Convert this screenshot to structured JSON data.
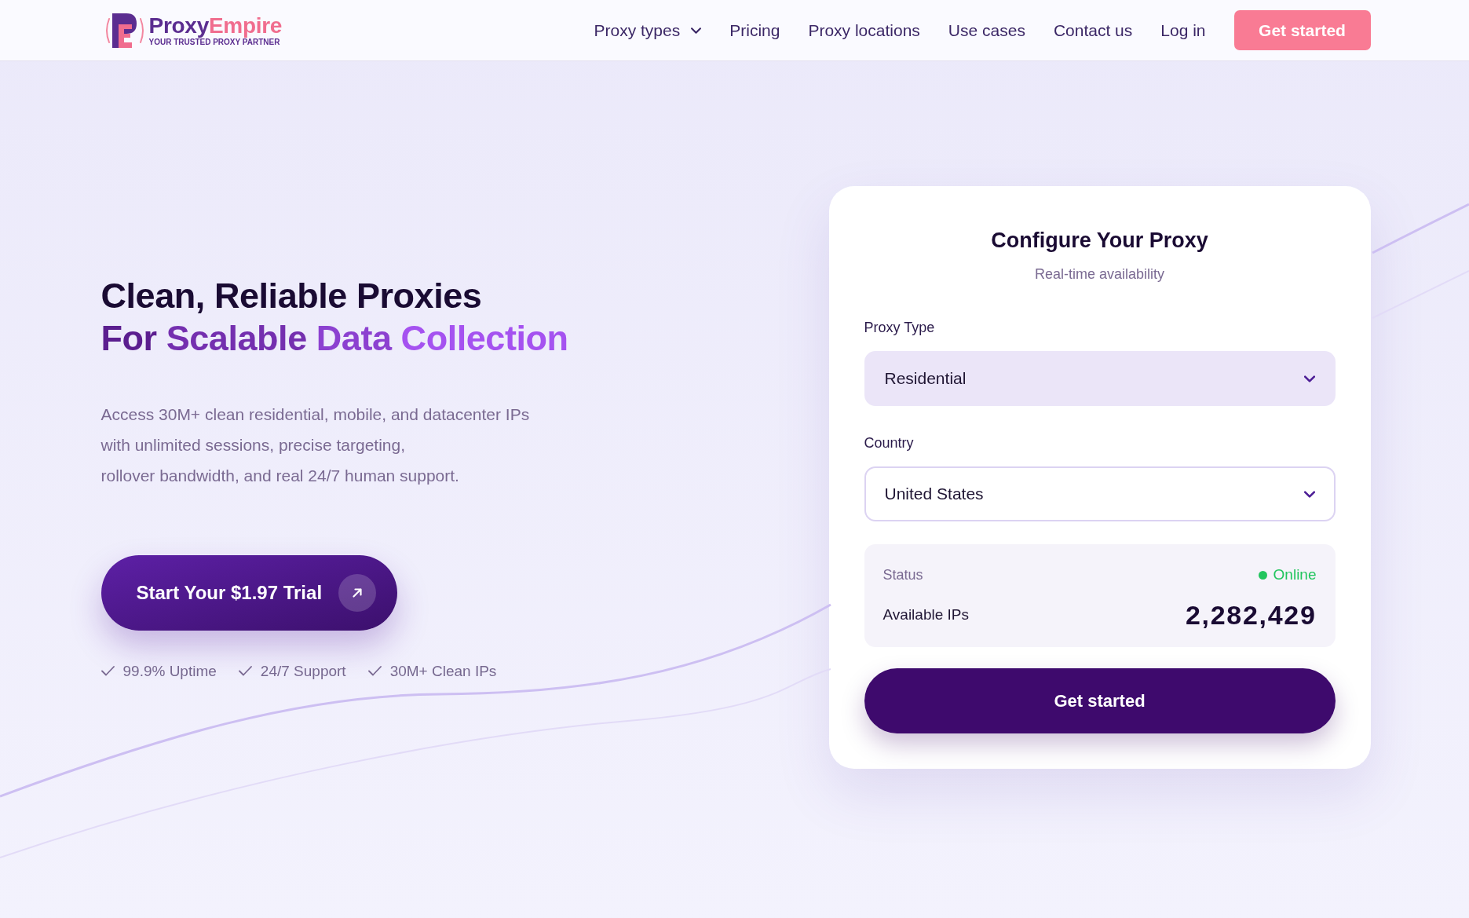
{
  "header": {
    "logo": {
      "wordmark": [
        "Proxy",
        "Empire"
      ],
      "tagline": "YOUR TRUSTED PROXY PARTNER"
    },
    "nav": [
      {
        "label": "Proxy types",
        "kind": "dropdown"
      },
      {
        "label": "Pricing",
        "kind": "link"
      },
      {
        "label": "Proxy locations",
        "kind": "link"
      },
      {
        "label": "Use cases",
        "kind": "link"
      },
      {
        "label": "Contact us",
        "kind": "link"
      },
      {
        "label": "Log in",
        "kind": "link"
      }
    ],
    "cta": "Get started"
  },
  "hero": {
    "title": "Clean, Reliable Proxies",
    "title_highlight": "For Scalable Data Collection",
    "description_lines": [
      "Access 30M+ clean residential, mobile, and datacenter IPs",
      "with unlimited sessions, precise targeting,",
      "rollover bandwidth, and real 24/7 human support."
    ],
    "cta": "Start Your $1.97 Trial",
    "features": [
      "99.9% Uptime",
      "24/7 Support",
      "30M+ Clean IPs"
    ]
  },
  "config_card": {
    "title": "Configure Your Proxy",
    "subtitle": "Real-time availability",
    "fields": [
      {
        "label": "Proxy Type",
        "value": "Residential",
        "kind": "filled"
      },
      {
        "label": "Country",
        "value": "United States",
        "kind": "outlined"
      }
    ],
    "status": {
      "label": "Status",
      "value": "Online",
      "online": true
    },
    "available_ips": {
      "label": "Available IPs",
      "value": "2,282,429"
    },
    "button": "Get started"
  }
}
